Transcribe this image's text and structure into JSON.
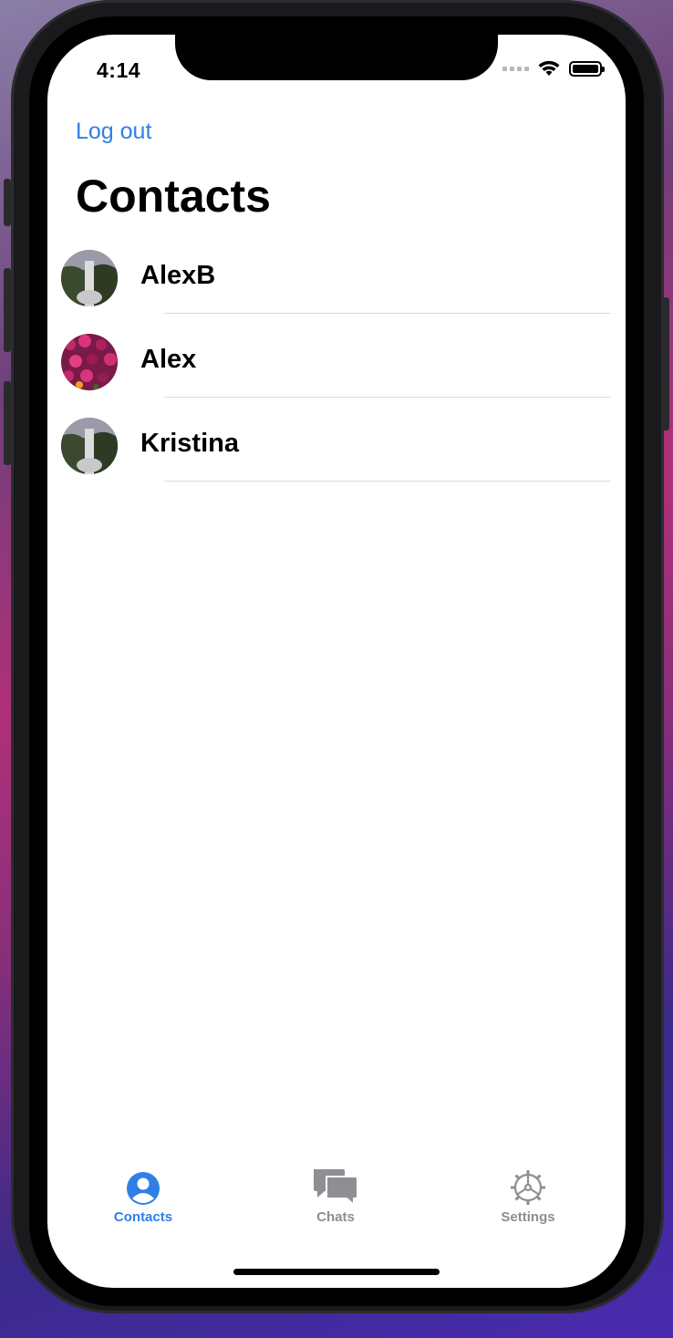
{
  "status_bar": {
    "time": "4:14"
  },
  "nav": {
    "logout_label": "Log out",
    "title": "Contacts"
  },
  "contacts": [
    {
      "name": "AlexB",
      "avatar": "waterfall-photo"
    },
    {
      "name": "Alex",
      "avatar": "flowers-photo"
    },
    {
      "name": "Kristina",
      "avatar": "waterfall-photo"
    }
  ],
  "tabbar": {
    "tabs": [
      {
        "label": "Contacts",
        "icon": "person-circle-icon",
        "active": true
      },
      {
        "label": "Chats",
        "icon": "chat-bubbles-icon",
        "active": false
      },
      {
        "label": "Settings",
        "icon": "gear-icon",
        "active": false
      }
    ]
  },
  "colors": {
    "accent": "#2f7fe6",
    "inactive": "#8e8e93"
  }
}
